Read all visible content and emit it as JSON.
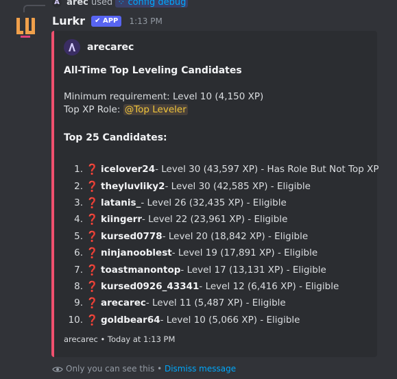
{
  "reply": {
    "user": "arec",
    "used_text": "used",
    "command": "config debug"
  },
  "message": {
    "bot_name": "Lurkr",
    "badge": "APP",
    "time": "1:13 PM"
  },
  "embed": {
    "accent_color": "#f0506e",
    "author": "arecarec",
    "title": "All-Time Top Leveling Candidates",
    "requirement": "Minimum requirement: Level 10 (4,150 XP)",
    "role_prefix": "Top XP Role: ",
    "role_mention": "@Top Leveler",
    "candidates_heading": "Top 25 Candidates:",
    "candidates": [
      {
        "n": "1.",
        "name": "icelover24",
        "detail": " - Level 30 (43,597 XP) - Has Role But Not Top XP"
      },
      {
        "n": "2.",
        "name": "theyluvliky2",
        "detail": " - Level 30 (42,585 XP) - Eligible"
      },
      {
        "n": "3.",
        "name": "latanis_",
        "detail": " - Level 26 (32,435 XP) - Eligible"
      },
      {
        "n": "4.",
        "name": "kiingerr",
        "detail": " - Level 22 (23,961 XP) - Eligible"
      },
      {
        "n": "5.",
        "name": "kursed0778",
        "detail": " - Level 20 (18,842 XP) - Eligible"
      },
      {
        "n": "6.",
        "name": "ninjanooblest",
        "detail": " - Level 19 (17,891 XP) - Eligible"
      },
      {
        "n": "7.",
        "name": "toastmanontop",
        "detail": " - Level 17 (13,131 XP) - Eligible"
      },
      {
        "n": "8.",
        "name": "kursed0926_43341",
        "detail": " - Level 12 (6,416 XP) - Eligible"
      },
      {
        "n": "9.",
        "name": "arecarec",
        "detail": " - Level 11 (5,487 XP) - Eligible"
      },
      {
        "n": "10.",
        "name": "goldbear64",
        "detail": " - Level 10 (5,066 XP) - Eligible"
      }
    ],
    "status_icon": "❓",
    "footer": "arecarec • Today at 1:13 PM"
  },
  "ephemeral": {
    "text": "Only you can see this • ",
    "dismiss": "Dismiss message"
  }
}
